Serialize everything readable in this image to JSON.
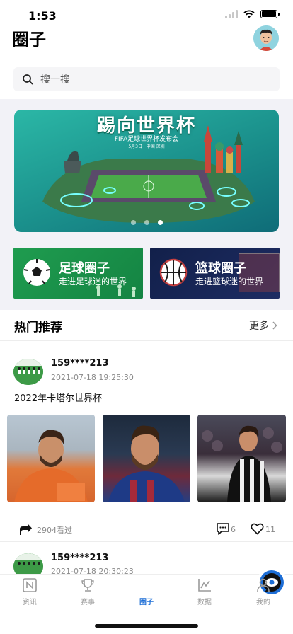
{
  "status": {
    "time": "1:53"
  },
  "header": {
    "title": "圈子"
  },
  "search": {
    "placeholder": "搜一搜"
  },
  "banner": {
    "title": "踢向世界杯",
    "subtitle": "FIFA足球世界杯发布会",
    "date": "5月3日 · 中国 深圳",
    "pages": 3,
    "active_page": 2
  },
  "categories": [
    {
      "title": "足球圈子",
      "subtitle": "走进足球迷的世界"
    },
    {
      "title": "篮球圈子",
      "subtitle": "走进篮球迷的世界"
    }
  ],
  "section": {
    "title": "热门推荐",
    "more_label": "更多"
  },
  "posts": [
    {
      "user": "159****213",
      "time": "2021-07-18 19:25:30",
      "text": "2022年卡塔尔世界杯",
      "views": "2904看过",
      "comments": "6",
      "likes": "11"
    },
    {
      "user": "159****213",
      "time": "2021-07-18 20:30:23"
    }
  ],
  "tabs": [
    {
      "label": "资讯",
      "icon": "news-icon"
    },
    {
      "label": "赛事",
      "icon": "trophy-icon"
    },
    {
      "label": "圈子",
      "icon": "eye-icon",
      "active": true
    },
    {
      "label": "数据",
      "icon": "chart-icon"
    },
    {
      "label": "我的",
      "icon": "user-icon"
    }
  ],
  "colors": {
    "accent": "#1d6ed6",
    "football": "#1f9c4f",
    "basketball": "#12204a"
  }
}
